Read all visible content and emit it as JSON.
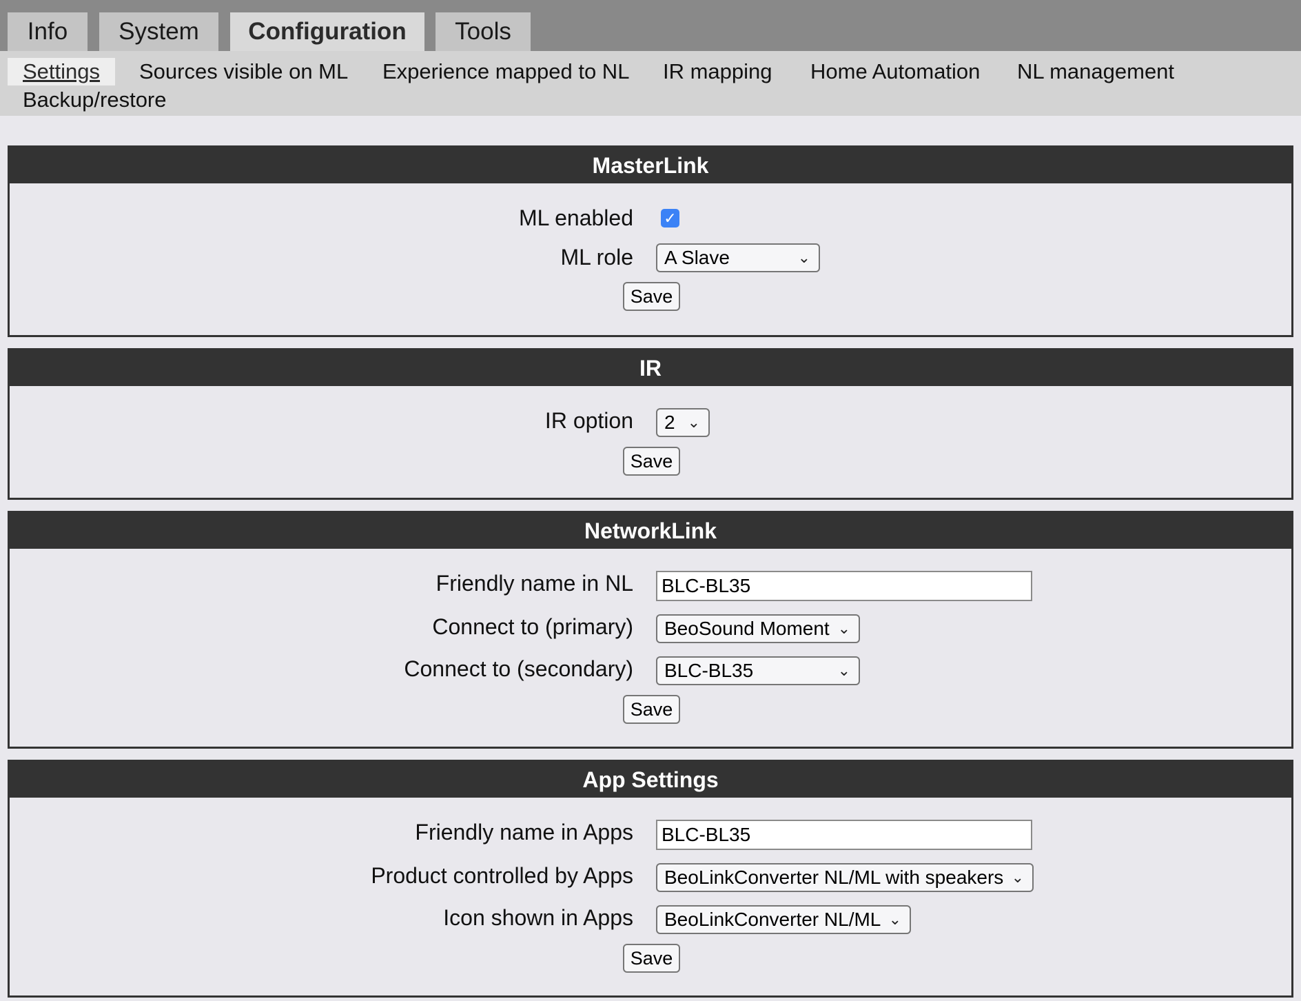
{
  "top_tabs": [
    "Info",
    "System",
    "Configuration",
    "Tools"
  ],
  "active_top_tab": "Configuration",
  "sub_nav": [
    "Settings",
    "Sources visible on ML",
    "Experience mapped to NL",
    "IR mapping",
    "Home Automation",
    "NL management",
    "Backup/restore"
  ],
  "active_sub_nav": "Settings",
  "masterlink": {
    "title": "MasterLink",
    "ml_enabled_label": "ML enabled",
    "ml_enabled_checked": true,
    "ml_role_label": "ML role",
    "ml_role_value": "A Slave",
    "save_label": "Save"
  },
  "ir": {
    "title": "IR",
    "ir_option_label": "IR option",
    "ir_option_value": "2",
    "save_label": "Save"
  },
  "networklink": {
    "title": "NetworkLink",
    "friendly_name_label": "Friendly name in NL",
    "friendly_name_value": "BLC-BL35",
    "primary_label": "Connect to (primary)",
    "primary_value": "BeoSound Moment",
    "secondary_label": "Connect to (secondary)",
    "secondary_value": "BLC-BL35",
    "save_label": "Save"
  },
  "app_settings": {
    "title": "App Settings",
    "friendly_name_label": "Friendly name in Apps",
    "friendly_name_value": "BLC-BL35",
    "product_label": "Product controlled by Apps",
    "product_value": "BeoLinkConverter NL/ML with speakers",
    "icon_label": "Icon shown in Apps",
    "icon_value": "BeoLinkConverter NL/ML",
    "save_label": "Save"
  },
  "icons": {
    "select_chevron": "chevron-down-icon",
    "checkbox_check": "checkmark-icon"
  },
  "colors": {
    "panel_header_bg": "#333333",
    "checkbox_accent": "#3b82f6",
    "top_bar_bg": "#898989"
  }
}
